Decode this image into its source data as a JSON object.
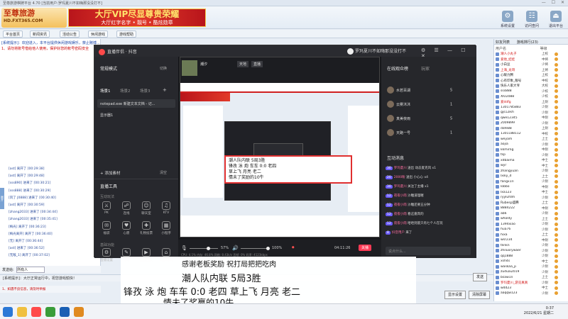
{
  "outer": {
    "titlebar": "至尊旅游棋牌平台 4.70 [当前用户:罗玛夏川不如嗨那没没打不]",
    "logo_main": "至尊旅游",
    "logo_sub": "HD.FXT365.COM",
    "vip_line1": "大厅VIP尽显尊贵荣耀",
    "vip_line2": "大厅红字名字 • 靓号 • 酷炫勋章",
    "top_icons": [
      {
        "label": "系统设置",
        "icon": "⚙"
      },
      {
        "label": "访问查问",
        "icon": "☷"
      },
      {
        "label": "退出平台",
        "icon": "⏏"
      }
    ],
    "tabs": [
      "平台首页",
      "新闻资讯",
      "活动公告",
      "休闲游戏",
      "游戏帮助"
    ],
    "log_header": "[系统提示]：欢迎进入，本平台提供休闲游戏娱乐，禁止赌博...",
    "log_notice": "1、请勿将账号借给他人使用，保护好您的帐号密码安全",
    "log_lines": [
      "[ast] 离开了 [00:29:38]",
      "[ast] 离开了 [00:29:48]",
      "[sss890] 进来了 [00:30:21]",
      "[sss888] 进来了 [00:30:29]",
      "[风了 J0888] 进来了 [00:30:40]",
      "[ast] 离开了 [00:30:59]",
      "[zhang2033] 进来了 [00:34:44]",
      "[zhang2033] 进来了 [00:35:41]",
      "[梅光] 离开了 [00:36:23]",
      "[梅光离开] 离开了 [00:36:40]",
      "[无] 离开了 [00:36:44]",
      "[ast] 进来了 [00:36:52]",
      "[无敌_1] 离开了 [00:37:02]"
    ],
    "send_label": "发送给:",
    "send_target": "所有人",
    "send_btn": "发送",
    "bottom_notice": "1、如遇不良信息，请及时举报",
    "status_text": "[系统提示]：大厅正常运行中，祝您游戏愉快！",
    "action_buttons": [
      "显示设置",
      "清除屏幕"
    ],
    "right_tabs": [
      "好友列表",
      "游戏排行(23)"
    ],
    "right_head": [
      "用户名",
      "等级"
    ],
    "users": [
      {
        "name": "潮人小丸子",
        "rank": "上校",
        "hl": true
      },
      {
        "name": "爱他_娃娃",
        "rank": "中将",
        "hl": true
      },
      {
        "name": "小白豆",
        "rank": "少将",
        "hl": false
      },
      {
        "name": "上海_龙哥",
        "rank": "上将",
        "hl": true
      },
      {
        "name": "心暖力腾",
        "rank": "上校",
        "hl": false
      },
      {
        "name": "心有印象_靓号",
        "rank": "中校",
        "hl": false
      },
      {
        "name": "快乐人家大爷",
        "rank": "大校",
        "hl": false
      },
      {
        "name": "sss888",
        "rank": "少校",
        "hl": false
      },
      {
        "name": "XIU2088",
        "rank": "少校",
        "hl": false
      },
      {
        "name": "爱ddfg",
        "rank": "上尉",
        "hl": true
      },
      {
        "name": "1301785883",
        "rank": "少尉",
        "hl": false
      },
      {
        "name": "gjs12ikh",
        "rank": "少尉",
        "hl": false
      },
      {
        "name": "qwe12345",
        "rank": "中尉",
        "hl": false
      },
      {
        "name": "2009899",
        "rank": "少尉",
        "hl": false
      },
      {
        "name": "dafe88",
        "rank": "上尉",
        "hl": false
      },
      {
        "name": "1301188112",
        "rank": "中校",
        "hl": false
      },
      {
        "name": "weyam",
        "rank": "上士",
        "hl": false
      },
      {
        "name": "aojia",
        "rank": "少尉",
        "hl": false
      },
      {
        "name": "kkmirng",
        "rank": "中尉",
        "hl": false
      },
      {
        "name": "tsp",
        "rank": "少尉",
        "hl": false
      },
      {
        "name": "xdbaima",
        "rank": "中士",
        "hl": false
      },
      {
        "name": "wyr",
        "rank": "中士",
        "hl": false
      },
      {
        "name": "zhangyuan",
        "rank": "少尉",
        "hl": false
      },
      {
        "name": "lxiky_d",
        "rank": "上士",
        "hl": false
      },
      {
        "name": "fangx1ri",
        "rank": "少尉",
        "hl": false
      },
      {
        "name": "lobbo",
        "rank": "中尉",
        "hl": false
      },
      {
        "name": "lxa123",
        "rank": "中士",
        "hl": false
      },
      {
        "name": "ryylufdm",
        "rank": "少尉",
        "hl": false
      },
      {
        "name": "Rubesp盛腾",
        "rank": "上士",
        "hl": false
      },
      {
        "name": "8884222",
        "rank": "中尉",
        "hl": false
      },
      {
        "name": "ab6",
        "rank": "少尉",
        "hl": false
      },
      {
        "name": "wholdy",
        "rank": "上士",
        "hl": false
      },
      {
        "name": "1394xiao",
        "rank": "少尉",
        "hl": false
      },
      {
        "name": "hua76",
        "rank": "少尉",
        "hl": false
      },
      {
        "name": "hixa",
        "rank": "上士",
        "hl": false
      },
      {
        "name": "wsr234",
        "rank": "中尉",
        "hl": false
      },
      {
        "name": "tlinkn",
        "rank": "少尉",
        "hl": false
      },
      {
        "name": "zhiluorywaer",
        "rank": "少尉",
        "hl": false
      },
      {
        "name": "qq1888",
        "rank": "少尉",
        "hl": false
      },
      {
        "name": "xsh4s",
        "rank": "中士",
        "hl": false
      },
      {
        "name": "waskaa_p",
        "rank": "少尉",
        "hl": false
      },
      {
        "name": "zuduai2019",
        "rank": "少尉",
        "hl": false
      },
      {
        "name": "bsaw1n",
        "rank": "上士",
        "hl": false
      },
      {
        "name": "罗玛夏川_游览真真",
        "rank": "少尉",
        "hl": true
      },
      {
        "name": "wdd23",
        "rank": "中士",
        "hl": false
      },
      {
        "name": "aaqqw123",
        "rank": "少尉",
        "hl": false
      }
    ]
  },
  "live": {
    "app_name": "直播伴侣 · 抖音",
    "user": "罗玛夏川不如嗨那没没打不",
    "left_header": "常规模式",
    "left_header_action": "切换",
    "scene_tabs": [
      "场景1",
      "场景2",
      "场景3"
    ],
    "sources": [
      "notepad.exe 新建文本文档 - 记...",
      "显示器1"
    ],
    "add_source": "+ 添加素材",
    "clear_label": "清空",
    "tools_header": "直播工具",
    "tools_sub1": "互动玩法",
    "tools_row1": [
      {
        "label": "PK",
        "icon": "⚔"
      },
      {
        "label": "连线",
        "icon": "☍"
      },
      {
        "label": "聊天室",
        "icon": "☺"
      },
      {
        "label": "KTV",
        "icon": "♫"
      }
    ],
    "tools_row2": [
      {
        "label": "福袋",
        "icon": "✉"
      },
      {
        "label": "心愿",
        "icon": "♥"
      },
      {
        "label": "礼物投票",
        "icon": "✚"
      },
      {
        "label": "小程序",
        "icon": "▦"
      }
    ],
    "tools_sub2": "基础功能",
    "tools_row3": [
      {
        "label": "直播设置",
        "icon": "⚙"
      },
      {
        "label": "弹幕",
        "icon": "✎"
      },
      {
        "label": "直播回放",
        "icon": "▶"
      },
      {
        "label": "抖音电商",
        "icon": "⌂"
      }
    ],
    "tools_row4": [
      {
        "label": "音效礼物",
        "icon": "♪"
      },
      {
        "label": "直播日志",
        "icon": "☰"
      },
      {
        "label": "主播任务",
        "icon": "★"
      },
      {
        "label": "小助手",
        "icon": "?"
      }
    ],
    "preview_anchor": "潮汐",
    "preview_tags": [
      "天地",
      "直播"
    ],
    "inner_overlay_lines": [
      "潮人队内联   5局3胜",
      "锋孜 泳 炮 车车 0:0 老四",
      "草上飞 月亮 老二",
      "情未了奖励的10牛"
    ],
    "volume1": "57%",
    "volume2": "100%",
    "live_time": "04:11:26",
    "live_time_label": "关播",
    "stats": "CPU: 4.1%   内存: 46.8%   网络: 8.43k/s   丢帧: 0%   码率: 4123kbps",
    "right_title": "在线观众榜",
    "right_title2": "玩家",
    "viewers": [
      {
        "name": "水若百湖",
        "count": "5"
      },
      {
        "name": "云雾沐沐",
        "count": "1"
      },
      {
        "name": "真美夜雨",
        "count": "5"
      },
      {
        "name": "天路一号",
        "count": "1"
      }
    ],
    "chat_title": "互动消息",
    "chats": [
      {
        "lv": "30",
        "user": "罗玛夏川",
        "text": "送出 动态麦克风 x1"
      },
      {
        "lv": "20",
        "user": "2000粉",
        "text": "送出 小心心 x4"
      },
      {
        "lv": "30",
        "user": "罗玛夏川",
        "text": "关注了主播 x1"
      },
      {
        "lv": "12",
        "user": "夜夜小雨",
        "text": "沙雕道理喔"
      },
      {
        "lv": "12",
        "user": "夜夜小雨",
        "text": "沙雕还要五分钟"
      },
      {
        "lv": "12",
        "user": "夜夜小雨",
        "text": "看这嘉宾的"
      },
      {
        "lv": "12",
        "user": "夜夜小雨",
        "text": "哈哈到底只有七个人在玩"
      },
      {
        "lv": "8",
        "user": "抖音用户",
        "text": "来了"
      }
    ],
    "chat_input_placeholder": "说点什么..."
  },
  "subtitles": [
    "感谢老板奖励 祝打局把把吃肉",
    "潮人队内联      5局3胜",
    "锋孜  泳  炮  车车  0:0  老四  草上飞  月亮  老二",
    "情未了奖赢的10牛",
    "感谢老板奖励 祝打局把把吃肉"
  ],
  "taskbar": {
    "time": "0:37",
    "date": "2022/6/21 星期二"
  },
  "colors": {
    "accent_red": "#d02020",
    "live_bg": "#1f2024",
    "vip_red": "#b8151b",
    "link_blue": "#2a4b9b"
  }
}
